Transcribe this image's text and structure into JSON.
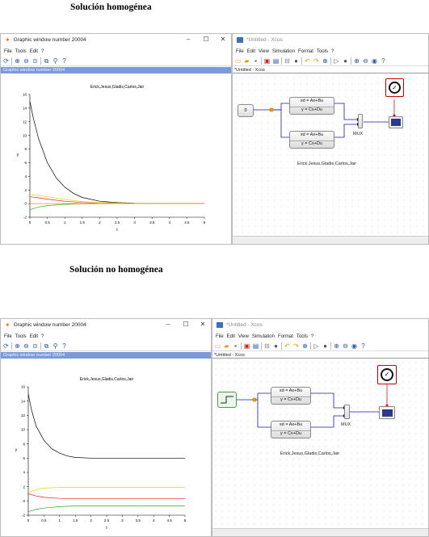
{
  "headings": {
    "top": "Solución homogénea",
    "bottom": "Solución no homogénea"
  },
  "graphic_window": {
    "title": "Graphic window number 20004",
    "menu": [
      "File",
      "Tools",
      "Edit",
      "?"
    ],
    "bar_label": "Graphic window number 20004",
    "window_controls": {
      "minimize": "–",
      "maximize": "☐",
      "close": "✕"
    }
  },
  "xcos_window": {
    "title": "*Untitled - Xcos",
    "menu": [
      "File",
      "Edit",
      "View",
      "Simulation",
      "Format",
      "Tools",
      "?"
    ],
    "tab_label": "*Untitled - Xcos",
    "block_labels": {
      "ss_top": "xd  =  Ax+Bu",
      "ss_bottom": "y  =  Cx+Du",
      "mux": "MUX",
      "step_const": "0"
    },
    "caption": "Erick,Jesus,Gladis,Carlos,Jair"
  },
  "colors": {
    "line_black": "#000000",
    "line_red": "#e02020",
    "line_yellow": "#f0d000",
    "line_green": "#20b020",
    "line_orange": "#f59a00",
    "link_blue": "#1a1ab0",
    "clock_red": "#d11",
    "titlebar_blue": "#7a9bd8"
  },
  "chart_data": [
    {
      "type": "line",
      "title": "Erick,Jesus,Gladis,Carlos,Jair",
      "xlabel": "t",
      "ylabel": "y",
      "xlim": [
        0,
        5
      ],
      "ylim": [
        -2,
        16
      ],
      "xticks": [
        "0",
        "0.5",
        "1",
        "1.5",
        "2",
        "2.5",
        "3",
        "3.5",
        "4",
        "4.5",
        "5"
      ],
      "yticks": [
        "-2",
        "0",
        "2",
        "4",
        "6",
        "8",
        "10",
        "12",
        "14",
        "16"
      ],
      "series": [
        {
          "color": "#000000",
          "x": [
            0,
            0.1,
            0.25,
            0.5,
            0.75,
            1,
            1.25,
            1.5,
            2,
            2.5,
            3,
            4,
            5
          ],
          "y": [
            15,
            12.5,
            9.5,
            6,
            3.8,
            2.4,
            1.5,
            0.9,
            0.35,
            0.15,
            0.05,
            0.01,
            0
          ]
        },
        {
          "color": "#f0d000",
          "x": [
            0,
            0.25,
            0.5,
            1,
            1.5,
            2,
            3,
            4,
            5
          ],
          "y": [
            1.3,
            1.2,
            1.0,
            0.6,
            0.3,
            0.15,
            0.03,
            0.01,
            0
          ]
        },
        {
          "color": "#e02020",
          "x": [
            0,
            0.25,
            0.5,
            1,
            1.5,
            2,
            3,
            4,
            5
          ],
          "y": [
            1.0,
            0.85,
            0.65,
            0.35,
            0.15,
            0.05,
            0.01,
            0,
            0
          ]
        },
        {
          "color": "#20b020",
          "x": [
            0,
            0.25,
            0.5,
            1,
            1.5,
            2,
            3,
            4,
            5
          ],
          "y": [
            -0.9,
            -0.5,
            -0.3,
            -0.1,
            -0.03,
            0,
            0,
            0,
            0
          ]
        },
        {
          "color": "#f59a00",
          "x": [
            0,
            1,
            2,
            3,
            4,
            5
          ],
          "y": [
            0,
            0,
            0,
            0,
            0,
            0
          ]
        }
      ]
    },
    {
      "type": "line",
      "title": "Erick,Jesus,Gladis,Carlos,Jair",
      "xlabel": "t",
      "ylabel": "y",
      "xlim": [
        0,
        5
      ],
      "ylim": [
        -2,
        16
      ],
      "xticks": [
        "0",
        "0.5",
        "1",
        "1.5",
        "2",
        "2.5",
        "3",
        "3.5",
        "4",
        "4.5",
        "5"
      ],
      "yticks": [
        "-2",
        "0",
        "2",
        "4",
        "6",
        "8",
        "10",
        "12",
        "14",
        "16"
      ],
      "series": [
        {
          "color": "#000000",
          "x": [
            0,
            0.1,
            0.25,
            0.5,
            0.75,
            1,
            1.25,
            1.5,
            2,
            2.5,
            3,
            4,
            5
          ],
          "y": [
            15,
            12.8,
            10.5,
            8.5,
            7.3,
            6.7,
            6.3,
            6.1,
            6.0,
            6.0,
            6.0,
            6.0,
            6.0
          ]
        },
        {
          "color": "#f0d000",
          "x": [
            0,
            0.25,
            0.5,
            1,
            1.5,
            2,
            3,
            4,
            5
          ],
          "y": [
            1.2,
            1.6,
            1.8,
            1.9,
            1.9,
            1.9,
            1.9,
            1.9,
            1.9
          ]
        },
        {
          "color": "#e02020",
          "x": [
            0,
            0.25,
            0.5,
            1,
            1.5,
            2,
            3,
            4,
            5
          ],
          "y": [
            1.0,
            0.7,
            0.5,
            0.35,
            0.3,
            0.3,
            0.3,
            0.3,
            0.3
          ]
        },
        {
          "color": "#20b020",
          "x": [
            0,
            0.25,
            0.5,
            1,
            1.5,
            2,
            3,
            4,
            5
          ],
          "y": [
            -1.5,
            -1.2,
            -1.0,
            -0.8,
            -0.7,
            -0.7,
            -0.7,
            -0.7,
            -0.7
          ]
        }
      ]
    }
  ]
}
